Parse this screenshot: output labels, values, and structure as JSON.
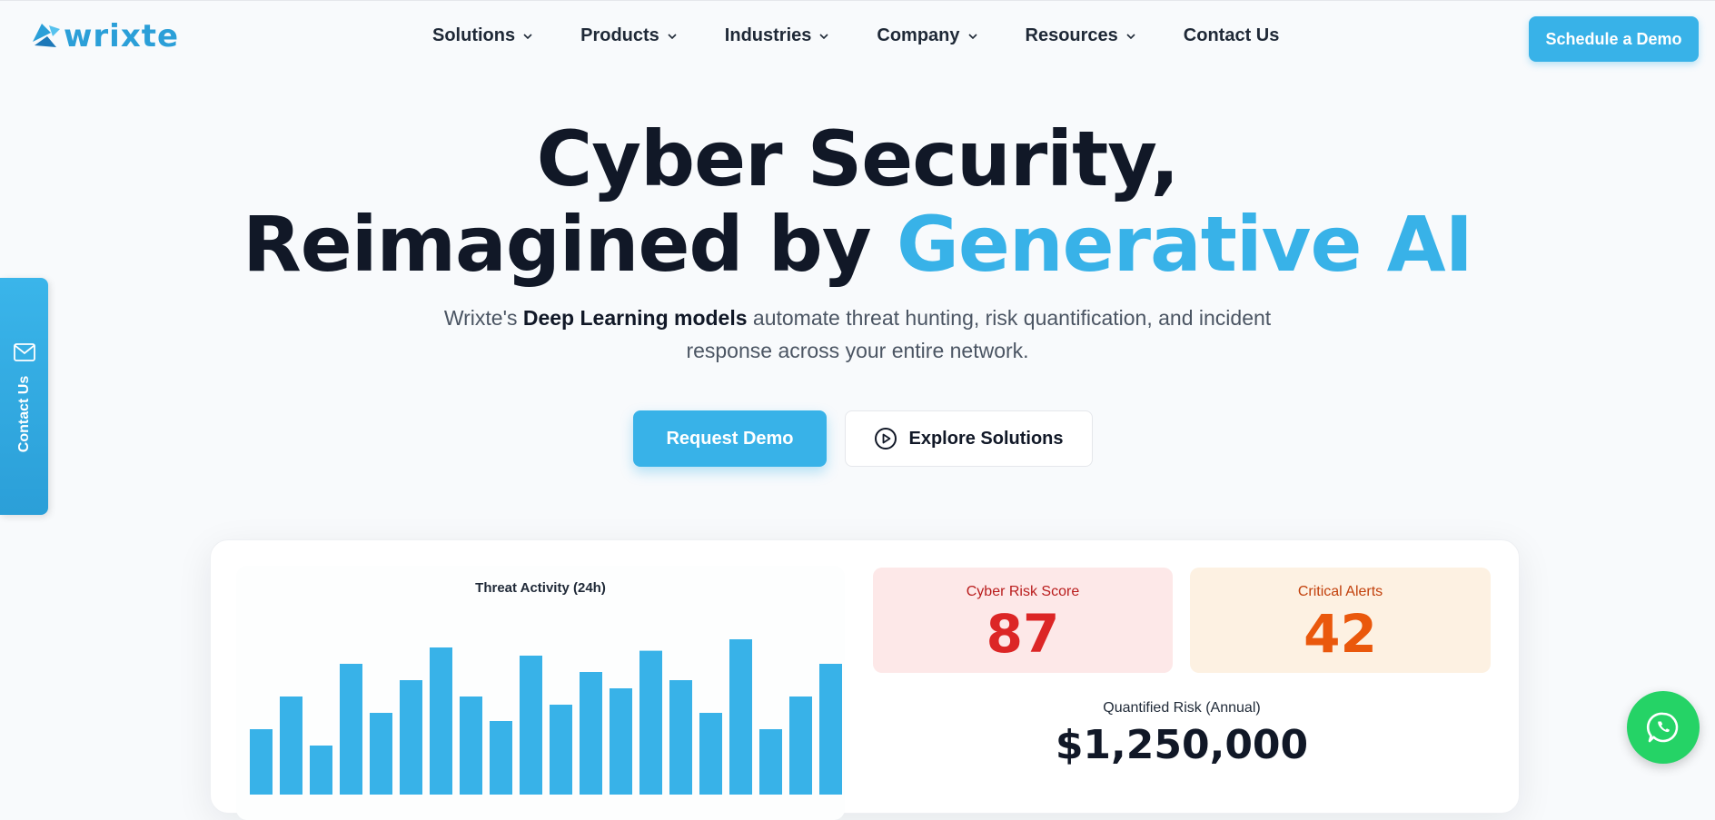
{
  "header": {
    "logo_text": "wrixte",
    "nav": [
      {
        "label": "Solutions",
        "has_dropdown": true
      },
      {
        "label": "Products",
        "has_dropdown": true
      },
      {
        "label": "Industries",
        "has_dropdown": true
      },
      {
        "label": "Company",
        "has_dropdown": true
      },
      {
        "label": "Resources",
        "has_dropdown": true
      },
      {
        "label": "Contact Us",
        "has_dropdown": false
      }
    ],
    "cta_label": "Schedule a Demo"
  },
  "hero": {
    "title_line1": "Cyber Security,",
    "title_line2_prefix": "Reimagined by",
    "title_line2_accent": "Generative AI",
    "subtitle_prefix": "Wrixte's",
    "subtitle_bold": "Deep Learning models",
    "subtitle_suffix": "automate threat hunting, risk quantification, and incident response across your entire network.",
    "primary_button": "Request Demo",
    "secondary_button": "Explore Solutions"
  },
  "side_tab": {
    "label": "Contact Us",
    "icon": "mail-icon"
  },
  "dashboard": {
    "risk_score_label": "Cyber Risk Score",
    "risk_score_value": "87",
    "critical_alerts_label": "Critical Alerts",
    "critical_alerts_value": "42",
    "quantified_risk_label": "Quantified Risk (Annual)",
    "quantified_risk_value": "$1,250,000"
  },
  "chart_data": {
    "type": "bar",
    "title": "Threat Activity (24h)",
    "xlabel": "",
    "ylabel": "",
    "values": [
      40,
      60,
      30,
      80,
      50,
      70,
      90,
      60,
      45,
      85,
      55,
      75,
      65,
      88,
      70,
      50,
      95,
      40,
      60,
      80
    ],
    "ylim": [
      0,
      100
    ],
    "grid": false,
    "bar_color": "#38b2e8"
  },
  "colors": {
    "accent": "#38b2e8",
    "risk_red": "#dc2626",
    "alert_orange": "#ea580c",
    "whatsapp_green": "#25d366"
  },
  "floating": {
    "icon": "whatsapp-icon"
  }
}
